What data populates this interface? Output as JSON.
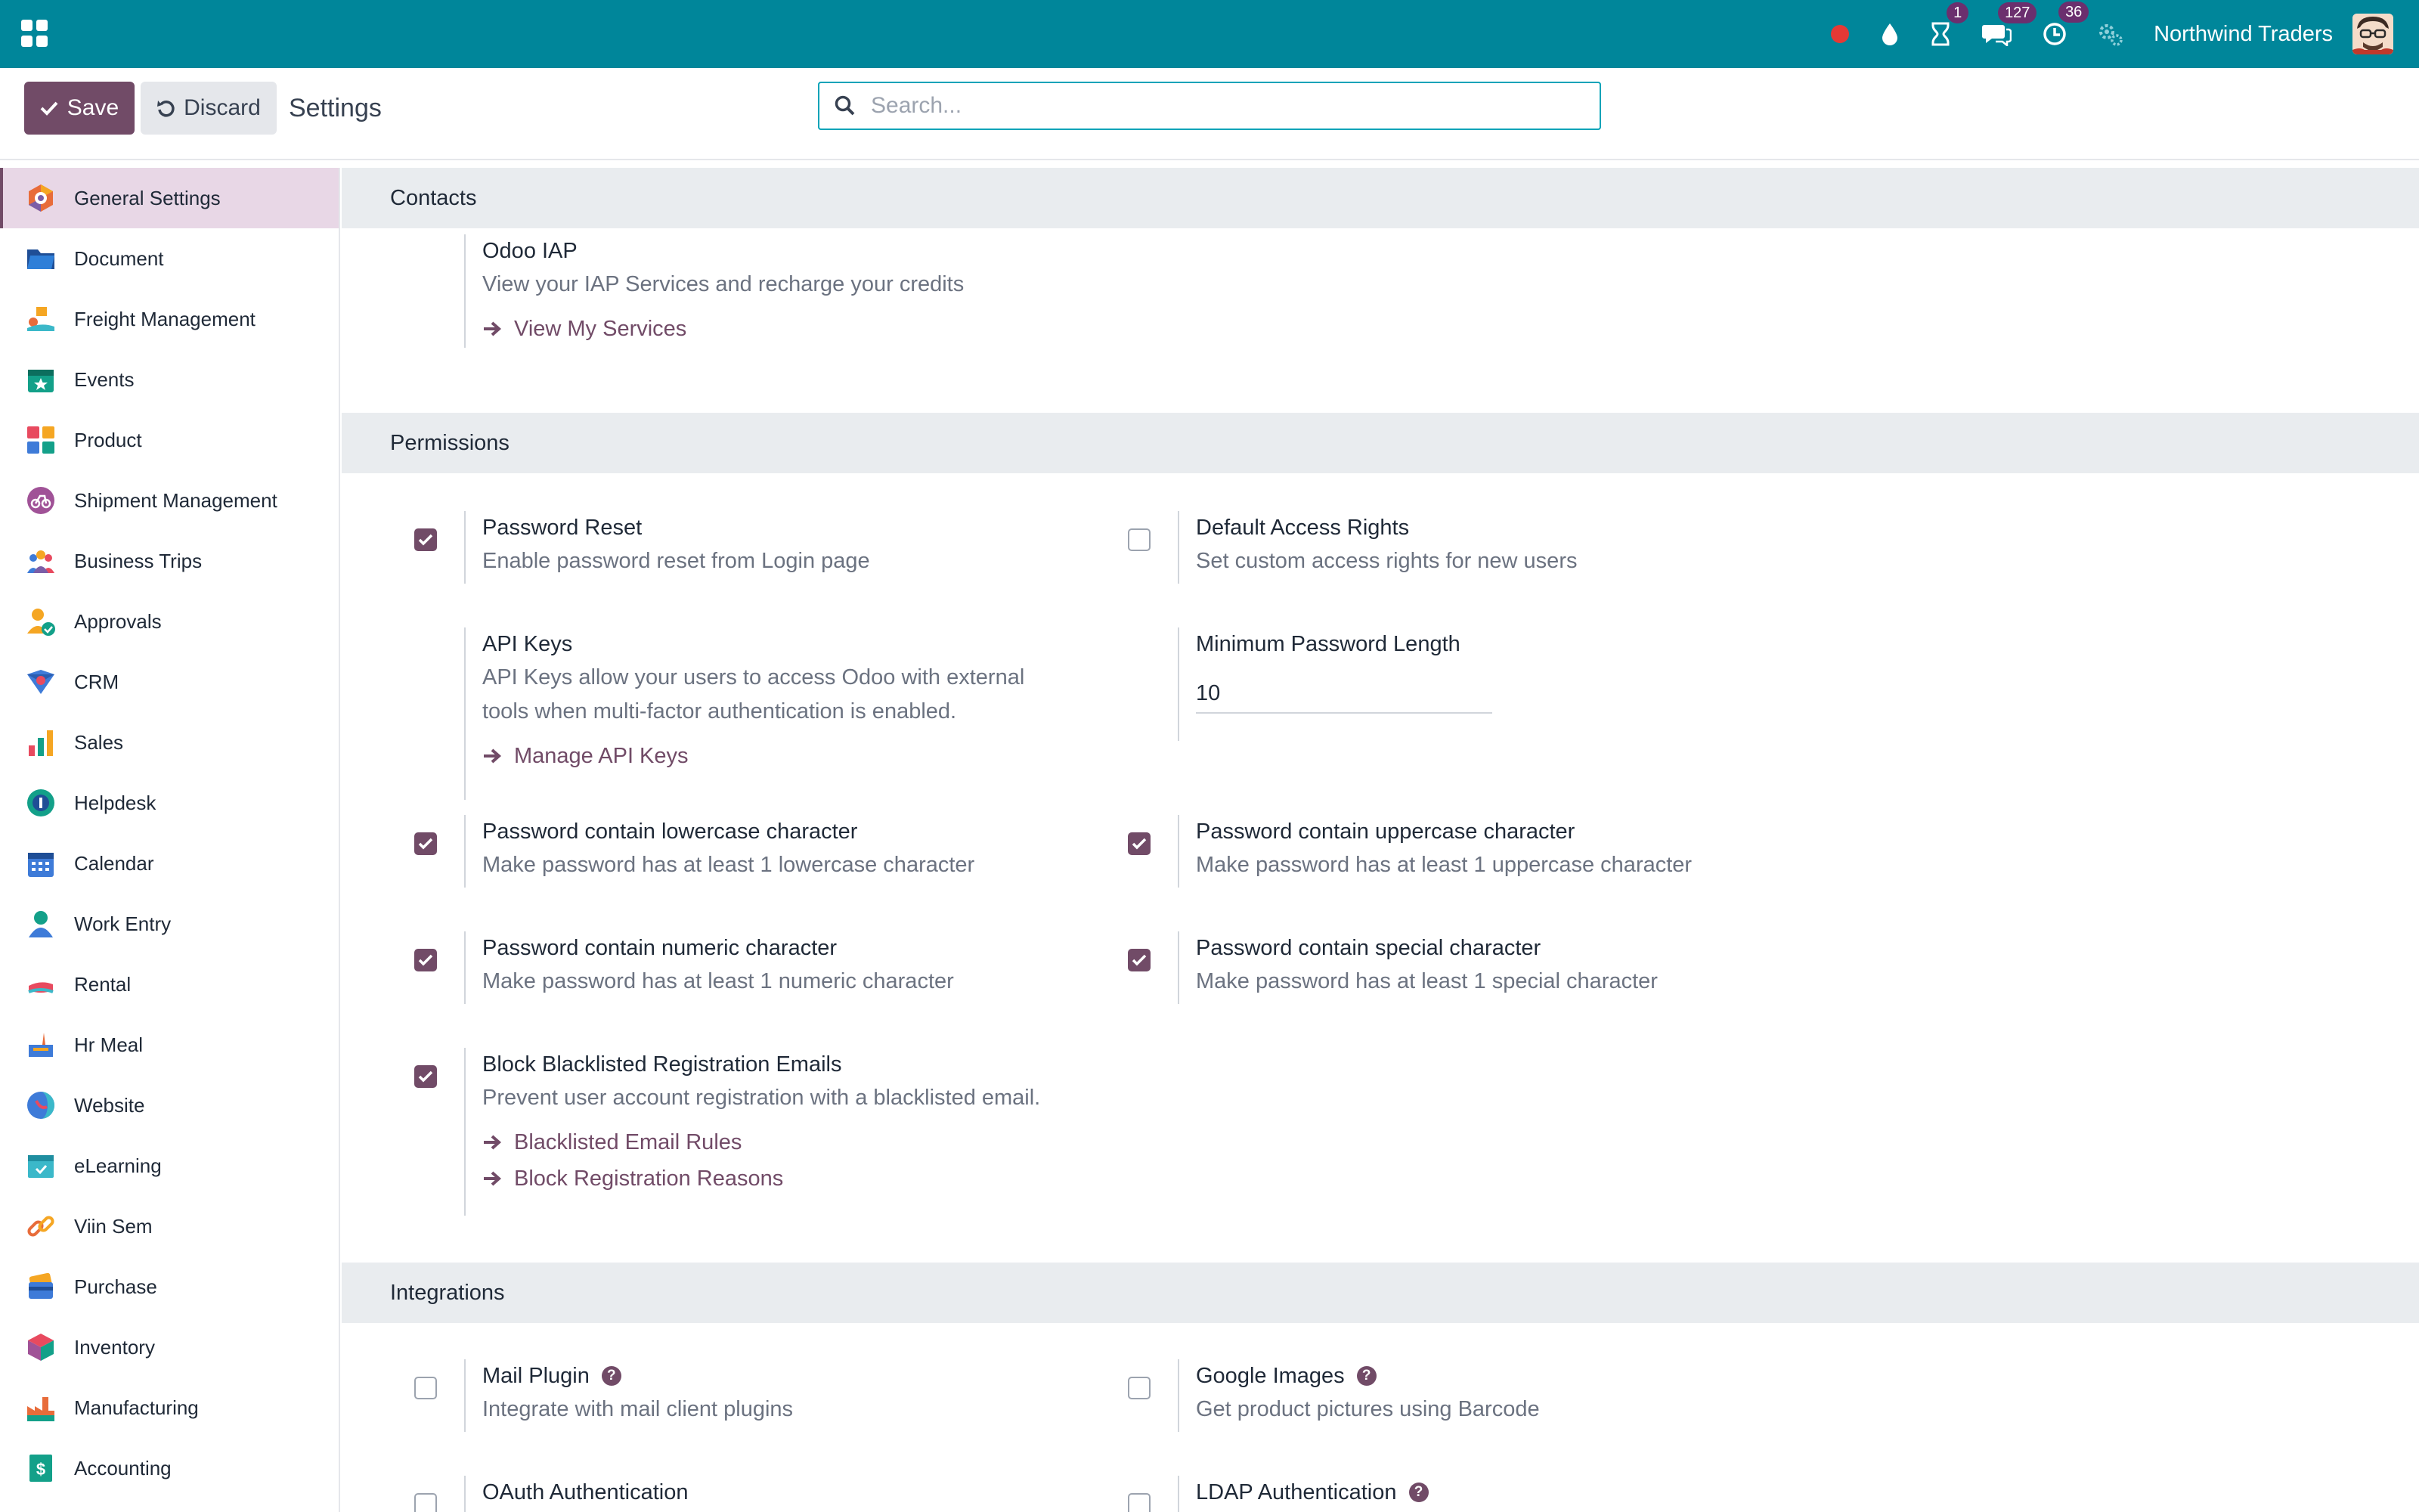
{
  "topbar": {
    "company": "Northwind Traders",
    "badges": {
      "activities": "1",
      "messages": "127",
      "timer": "36"
    },
    "colors": {
      "bar": "#00869a",
      "badge": "#6b2f6e",
      "record": "#e53935"
    }
  },
  "control": {
    "save_label": "Save",
    "discard_label": "Discard",
    "title": "Settings",
    "search_placeholder": "Search..."
  },
  "sidebar": {
    "items": [
      {
        "label": "General Settings",
        "icon": "settings-icon"
      },
      {
        "label": "Document",
        "icon": "folder-icon"
      },
      {
        "label": "Freight Management",
        "icon": "freight-icon"
      },
      {
        "label": "Events",
        "icon": "calendar-star-icon"
      },
      {
        "label": "Product",
        "icon": "product-blocks-icon"
      },
      {
        "label": "Shipment Management",
        "icon": "shipment-icon"
      },
      {
        "label": "Business Trips",
        "icon": "people-icon"
      },
      {
        "label": "Approvals",
        "icon": "approval-user-icon"
      },
      {
        "label": "CRM",
        "icon": "crm-icon"
      },
      {
        "label": "Sales",
        "icon": "sales-chart-icon"
      },
      {
        "label": "Helpdesk",
        "icon": "helpdesk-icon"
      },
      {
        "label": "Calendar",
        "icon": "calendar-icon"
      },
      {
        "label": "Work Entry",
        "icon": "work-entry-icon"
      },
      {
        "label": "Rental",
        "icon": "rental-icon"
      },
      {
        "label": "Hr Meal",
        "icon": "meal-icon"
      },
      {
        "label": "Website",
        "icon": "website-icon"
      },
      {
        "label": "eLearning",
        "icon": "elearning-icon"
      },
      {
        "label": "Viin Sem",
        "icon": "link-icon"
      },
      {
        "label": "Purchase",
        "icon": "card-icon"
      },
      {
        "label": "Inventory",
        "icon": "box-icon"
      },
      {
        "label": "Manufacturing",
        "icon": "factory-icon"
      },
      {
        "label": "Accounting",
        "icon": "invoice-icon"
      }
    ]
  },
  "contacts": {
    "heading": "Contacts",
    "iap": {
      "title": "Odoo IAP",
      "desc": "View your IAP Services and recharge your credits",
      "link": "View My Services"
    }
  },
  "permissions": {
    "heading": "Permissions",
    "password_reset": {
      "title": "Password Reset",
      "desc": "Enable password reset from Login page",
      "checked": true
    },
    "default_access": {
      "title": "Default Access Rights",
      "desc": "Set custom access rights for new users",
      "checked": false
    },
    "api_keys": {
      "title": "API Keys",
      "desc1": "API Keys allow your users to access Odoo with external",
      "desc2": "tools when multi-factor authentication is enabled.",
      "link": "Manage API Keys"
    },
    "min_length": {
      "title": "Minimum Password Length",
      "value": "10"
    },
    "lowercase": {
      "title": "Password contain lowercase character",
      "desc": "Make password has at least 1 lowercase character",
      "checked": true
    },
    "uppercase": {
      "title": "Password contain uppercase character",
      "desc": "Make password has at least 1 uppercase character",
      "checked": true
    },
    "numeric": {
      "title": "Password contain numeric character",
      "desc": "Make password has at least 1 numeric character",
      "checked": true
    },
    "special": {
      "title": "Password contain special character",
      "desc": "Make password has at least 1 special character",
      "checked": true
    },
    "blacklist": {
      "title": "Block Blacklisted Registration Emails",
      "desc": "Prevent user account registration with a blacklisted email.",
      "link1": "Blacklisted Email Rules",
      "link2": "Block Registration Reasons",
      "checked": true
    }
  },
  "integrations": {
    "heading": "Integrations",
    "mail_plugin": {
      "title": "Mail Plugin",
      "desc": "Integrate with mail client plugins",
      "checked": false
    },
    "google_images": {
      "title": "Google Images",
      "desc": "Get product pictures using Barcode",
      "checked": false
    },
    "oauth": {
      "title": "OAuth Authentication",
      "checked": false
    },
    "ldap": {
      "title": "LDAP Authentication",
      "checked": false
    }
  },
  "accent_color": "#714b67"
}
